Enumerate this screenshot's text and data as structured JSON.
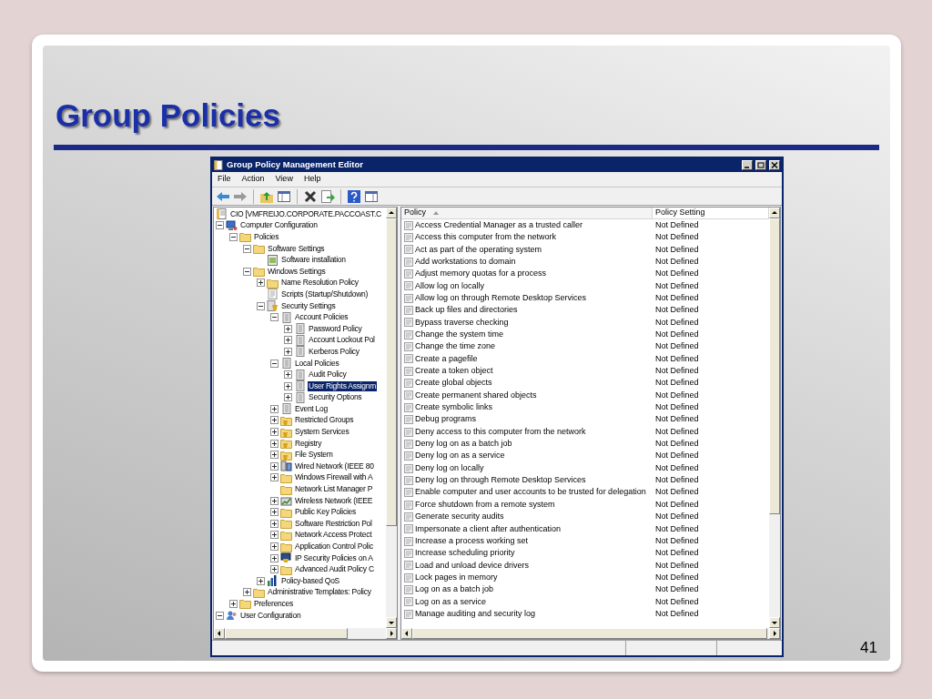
{
  "slide": {
    "title": "Group Policies",
    "page_number": "41"
  },
  "window": {
    "title": "Group Policy Management Editor",
    "menu": [
      "File",
      "Action",
      "View",
      "Help"
    ],
    "toolbar": [
      {
        "kind": "back"
      },
      {
        "kind": "forward"
      },
      {
        "kind": "sep"
      },
      {
        "kind": "up"
      },
      {
        "kind": "pane"
      },
      {
        "kind": "sep"
      },
      {
        "kind": "delete"
      },
      {
        "kind": "export"
      },
      {
        "kind": "sep"
      },
      {
        "kind": "help"
      },
      {
        "kind": "properties"
      }
    ],
    "tree": [
      {
        "label": "CIO [VMFREIJO.CORPORATE.PACCOAST.C",
        "kind": "doc",
        "selected": false
      },
      {
        "label": "Computer Configuration",
        "kind": "computer",
        "expanded": true,
        "selected": false,
        "children": [
          {
            "label": "Policies",
            "kind": "folder",
            "expanded": true,
            "selected": false,
            "children": [
              {
                "label": "Software Settings",
                "kind": "folder",
                "expanded": true,
                "selected": false,
                "children": [
                  {
                    "label": "Software installation",
                    "kind": "install",
                    "selected": false
                  }
                ]
              },
              {
                "label": "Windows Settings",
                "kind": "folder",
                "expanded": true,
                "selected": false,
                "children": [
                  {
                    "label": "Name Resolution Policy",
                    "kind": "folder",
                    "expanded": false,
                    "selected": false
                  },
                  {
                    "label": "Scripts (Startup/Shutdown)",
                    "kind": "scripts",
                    "selected": false
                  },
                  {
                    "label": "Security Settings",
                    "kind": "security",
                    "expanded": true,
                    "selected": false,
                    "children": [
                      {
                        "label": "Account Policies",
                        "kind": "policy",
                        "expanded": true,
                        "selected": false,
                        "children": [
                          {
                            "label": "Password Policy",
                            "kind": "policy",
                            "expanded": false,
                            "selected": false
                          },
                          {
                            "label": "Account Lockout Pol",
                            "kind": "policy",
                            "expanded": false,
                            "selected": false
                          },
                          {
                            "label": "Kerberos Policy",
                            "kind": "policy",
                            "expanded": false,
                            "selected": false
                          }
                        ]
                      },
                      {
                        "label": "Local Policies",
                        "kind": "policy",
                        "expanded": true,
                        "selected": false,
                        "children": [
                          {
                            "label": "Audit Policy",
                            "kind": "policy",
                            "expanded": false,
                            "selected": false
                          },
                          {
                            "label": "User Rights Assignm",
                            "kind": "policy",
                            "expanded": false,
                            "selected": true
                          },
                          {
                            "label": "Security Options",
                            "kind": "policy",
                            "expanded": false,
                            "selected": false
                          }
                        ]
                      },
                      {
                        "label": "Event Log",
                        "kind": "policy",
                        "expanded": false,
                        "selected": false
                      },
                      {
                        "label": "Restricted Groups",
                        "kind": "shield-folder",
                        "expanded": false,
                        "selected": false
                      },
                      {
                        "label": "System Services",
                        "kind": "shield-folder",
                        "expanded": false,
                        "selected": false
                      },
                      {
                        "label": "Registry",
                        "kind": "shield-folder",
                        "expanded": false,
                        "selected": false
                      },
                      {
                        "label": "File System",
                        "kind": "shield-folder",
                        "expanded": false,
                        "selected": false
                      },
                      {
                        "label": "Wired Network (IEEE 80",
                        "kind": "network",
                        "expanded": false,
                        "selected": false
                      },
                      {
                        "label": "Windows Firewall with A",
                        "kind": "folder",
                        "expanded": false,
                        "selected": false
                      },
                      {
                        "label": "Network List Manager P",
                        "kind": "folder",
                        "selected": false
                      },
                      {
                        "label": "Wireless Network (IEEE",
                        "kind": "wireless",
                        "expanded": false,
                        "selected": false
                      },
                      {
                        "label": "Public Key Policies",
                        "kind": "folder",
                        "expanded": false,
                        "selected": false
                      },
                      {
                        "label": "Software Restriction Pol",
                        "kind": "folder",
                        "expanded": false,
                        "selected": false
                      },
                      {
                        "label": "Network Access Protect",
                        "kind": "folder",
                        "expanded": false,
                        "selected": false
                      },
                      {
                        "label": "Application Control Polic",
                        "kind": "folder",
                        "expanded": false,
                        "selected": false
                      },
                      {
                        "label": "IP Security Policies on A",
                        "kind": "ip",
                        "expanded": false,
                        "selected": false
                      },
                      {
                        "label": "Advanced Audit Policy C",
                        "kind": "folder",
                        "expanded": false,
                        "selected": false
                      }
                    ]
                  },
                  {
                    "label": "Policy-based QoS",
                    "kind": "chart",
                    "expanded": false,
                    "selected": false
                  }
                ]
              },
              {
                "label": "Administrative Templates: Policy",
                "kind": "folder",
                "expanded": false,
                "selected": false
              }
            ]
          },
          {
            "label": "Preferences",
            "kind": "folder",
            "expanded": false,
            "selected": false
          }
        ]
      },
      {
        "label": "User Configuration",
        "kind": "user",
        "expanded": true,
        "selected": false
      }
    ],
    "table": {
      "columns": [
        {
          "label": "Policy",
          "sorted": true
        },
        {
          "label": "Policy Setting",
          "sorted": false
        }
      ],
      "rows": [
        {
          "policy": "Access Credential Manager as a trusted caller",
          "setting": "Not Defined"
        },
        {
          "policy": "Access this computer from the network",
          "setting": "Not Defined"
        },
        {
          "policy": "Act as part of the operating system",
          "setting": "Not Defined"
        },
        {
          "policy": "Add workstations to domain",
          "setting": "Not Defined"
        },
        {
          "policy": "Adjust memory quotas for a process",
          "setting": "Not Defined"
        },
        {
          "policy": "Allow log on locally",
          "setting": "Not Defined"
        },
        {
          "policy": "Allow log on through Remote Desktop Services",
          "setting": "Not Defined"
        },
        {
          "policy": "Back up files and directories",
          "setting": "Not Defined"
        },
        {
          "policy": "Bypass traverse checking",
          "setting": "Not Defined"
        },
        {
          "policy": "Change the system time",
          "setting": "Not Defined"
        },
        {
          "policy": "Change the time zone",
          "setting": "Not Defined"
        },
        {
          "policy": "Create a pagefile",
          "setting": "Not Defined"
        },
        {
          "policy": "Create a token object",
          "setting": "Not Defined"
        },
        {
          "policy": "Create global objects",
          "setting": "Not Defined"
        },
        {
          "policy": "Create permanent shared objects",
          "setting": "Not Defined"
        },
        {
          "policy": "Create symbolic links",
          "setting": "Not Defined"
        },
        {
          "policy": "Debug programs",
          "setting": "Not Defined"
        },
        {
          "policy": "Deny access to this computer from the network",
          "setting": "Not Defined"
        },
        {
          "policy": "Deny log on as a batch job",
          "setting": "Not Defined"
        },
        {
          "policy": "Deny log on as a service",
          "setting": "Not Defined"
        },
        {
          "policy": "Deny log on locally",
          "setting": "Not Defined"
        },
        {
          "policy": "Deny log on through Remote Desktop Services",
          "setting": "Not Defined"
        },
        {
          "policy": "Enable computer and user accounts to be trusted for delegation",
          "setting": "Not Defined"
        },
        {
          "policy": "Force shutdown from a remote system",
          "setting": "Not Defined"
        },
        {
          "policy": "Generate security audits",
          "setting": "Not Defined"
        },
        {
          "policy": "Impersonate a client after authentication",
          "setting": "Not Defined"
        },
        {
          "policy": "Increase a process working set",
          "setting": "Not Defined"
        },
        {
          "policy": "Increase scheduling priority",
          "setting": "Not Defined"
        },
        {
          "policy": "Load and unload device drivers",
          "setting": "Not Defined"
        },
        {
          "policy": "Lock pages in memory",
          "setting": "Not Defined"
        },
        {
          "policy": "Log on as a batch job",
          "setting": "Not Defined"
        },
        {
          "policy": "Log on as a service",
          "setting": "Not Defined"
        },
        {
          "policy": "Manage auditing and security log",
          "setting": "Not Defined"
        }
      ]
    }
  }
}
